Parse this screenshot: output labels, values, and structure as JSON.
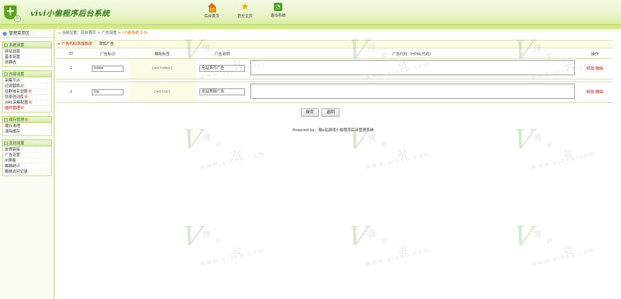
{
  "header": {
    "title": "vivi小偷程序后台系统",
    "nav": [
      {
        "label": "后台首页",
        "icon": "home-icon"
      },
      {
        "label": "官方主页",
        "icon": "star-icon"
      },
      {
        "label": "退出系统",
        "icon": "rss-icon"
      }
    ]
  },
  "sidebar": {
    "title": "管理菜单区",
    "groups": [
      {
        "label": "系统设置",
        "items": [
          {
            "label": "网站设置"
          },
          {
            "label": "基本设置"
          },
          {
            "label": "伪静态"
          }
        ]
      },
      {
        "label": "内容设置",
        "items": [
          {
            "label": "采集节点"
          },
          {
            "label": "过滤替换",
            "new": "新"
          },
          {
            "label": "站群域名设置",
            "new": "新"
          },
          {
            "label": "伪原创词库",
            "new": "新"
          },
          {
            "label": "XML采集配置",
            "new": "新"
          },
          {
            "label": "插件管理",
            "new": "新",
            "active": true
          }
        ]
      },
      {
        "label": "缓存管理",
        "new": "新",
        "items": [
          {
            "label": "缓存清理"
          },
          {
            "label": "清除缓存"
          }
        ]
      },
      {
        "label": "其他设置",
        "items": [
          {
            "label": "友情链接"
          },
          {
            "label": "广告设置"
          },
          {
            "label": "IP屏蔽"
          },
          {
            "label": "蜘蛛统计"
          },
          {
            "label": "蜘蛛访问记录"
          }
        ]
      }
    ]
  },
  "breadcrumb": {
    "prefix": "当前位置：",
    "path": "后台首页 > 广告设置 > ",
    "current": "(小偷系统 3.0)"
  },
  "toolbar": {
    "links": [
      "广告代码添加修改",
      "添加广告"
    ]
  },
  "table": {
    "headers": [
      "ID",
      "广告标识",
      "模板标签",
      "广告说明",
      "广告代码（HTML代码）",
      "操作"
    ],
    "rows": [
      {
        "id": "2",
        "name": "index",
        "tag": "{ad:index}",
        "desc": "全站首页广告",
        "code": "",
        "actions": [
          "修改",
          "删除"
        ]
      },
      {
        "id": "1",
        "name": "top",
        "tag": "{ad:top}",
        "desc": "全站顶部广告",
        "code": "",
        "actions": [
          "修改",
          "删除"
        ]
      }
    ]
  },
  "buttons": {
    "save": "保存",
    "back": "返回"
  },
  "footer": {
    "text": "Powered by：微e站游戏小偷程序后台管理系统"
  },
  "watermark": {
    "text1": "微",
    "text2": "e",
    "text3": "站",
    "url": "www.vioee.com",
    "v": "V"
  }
}
